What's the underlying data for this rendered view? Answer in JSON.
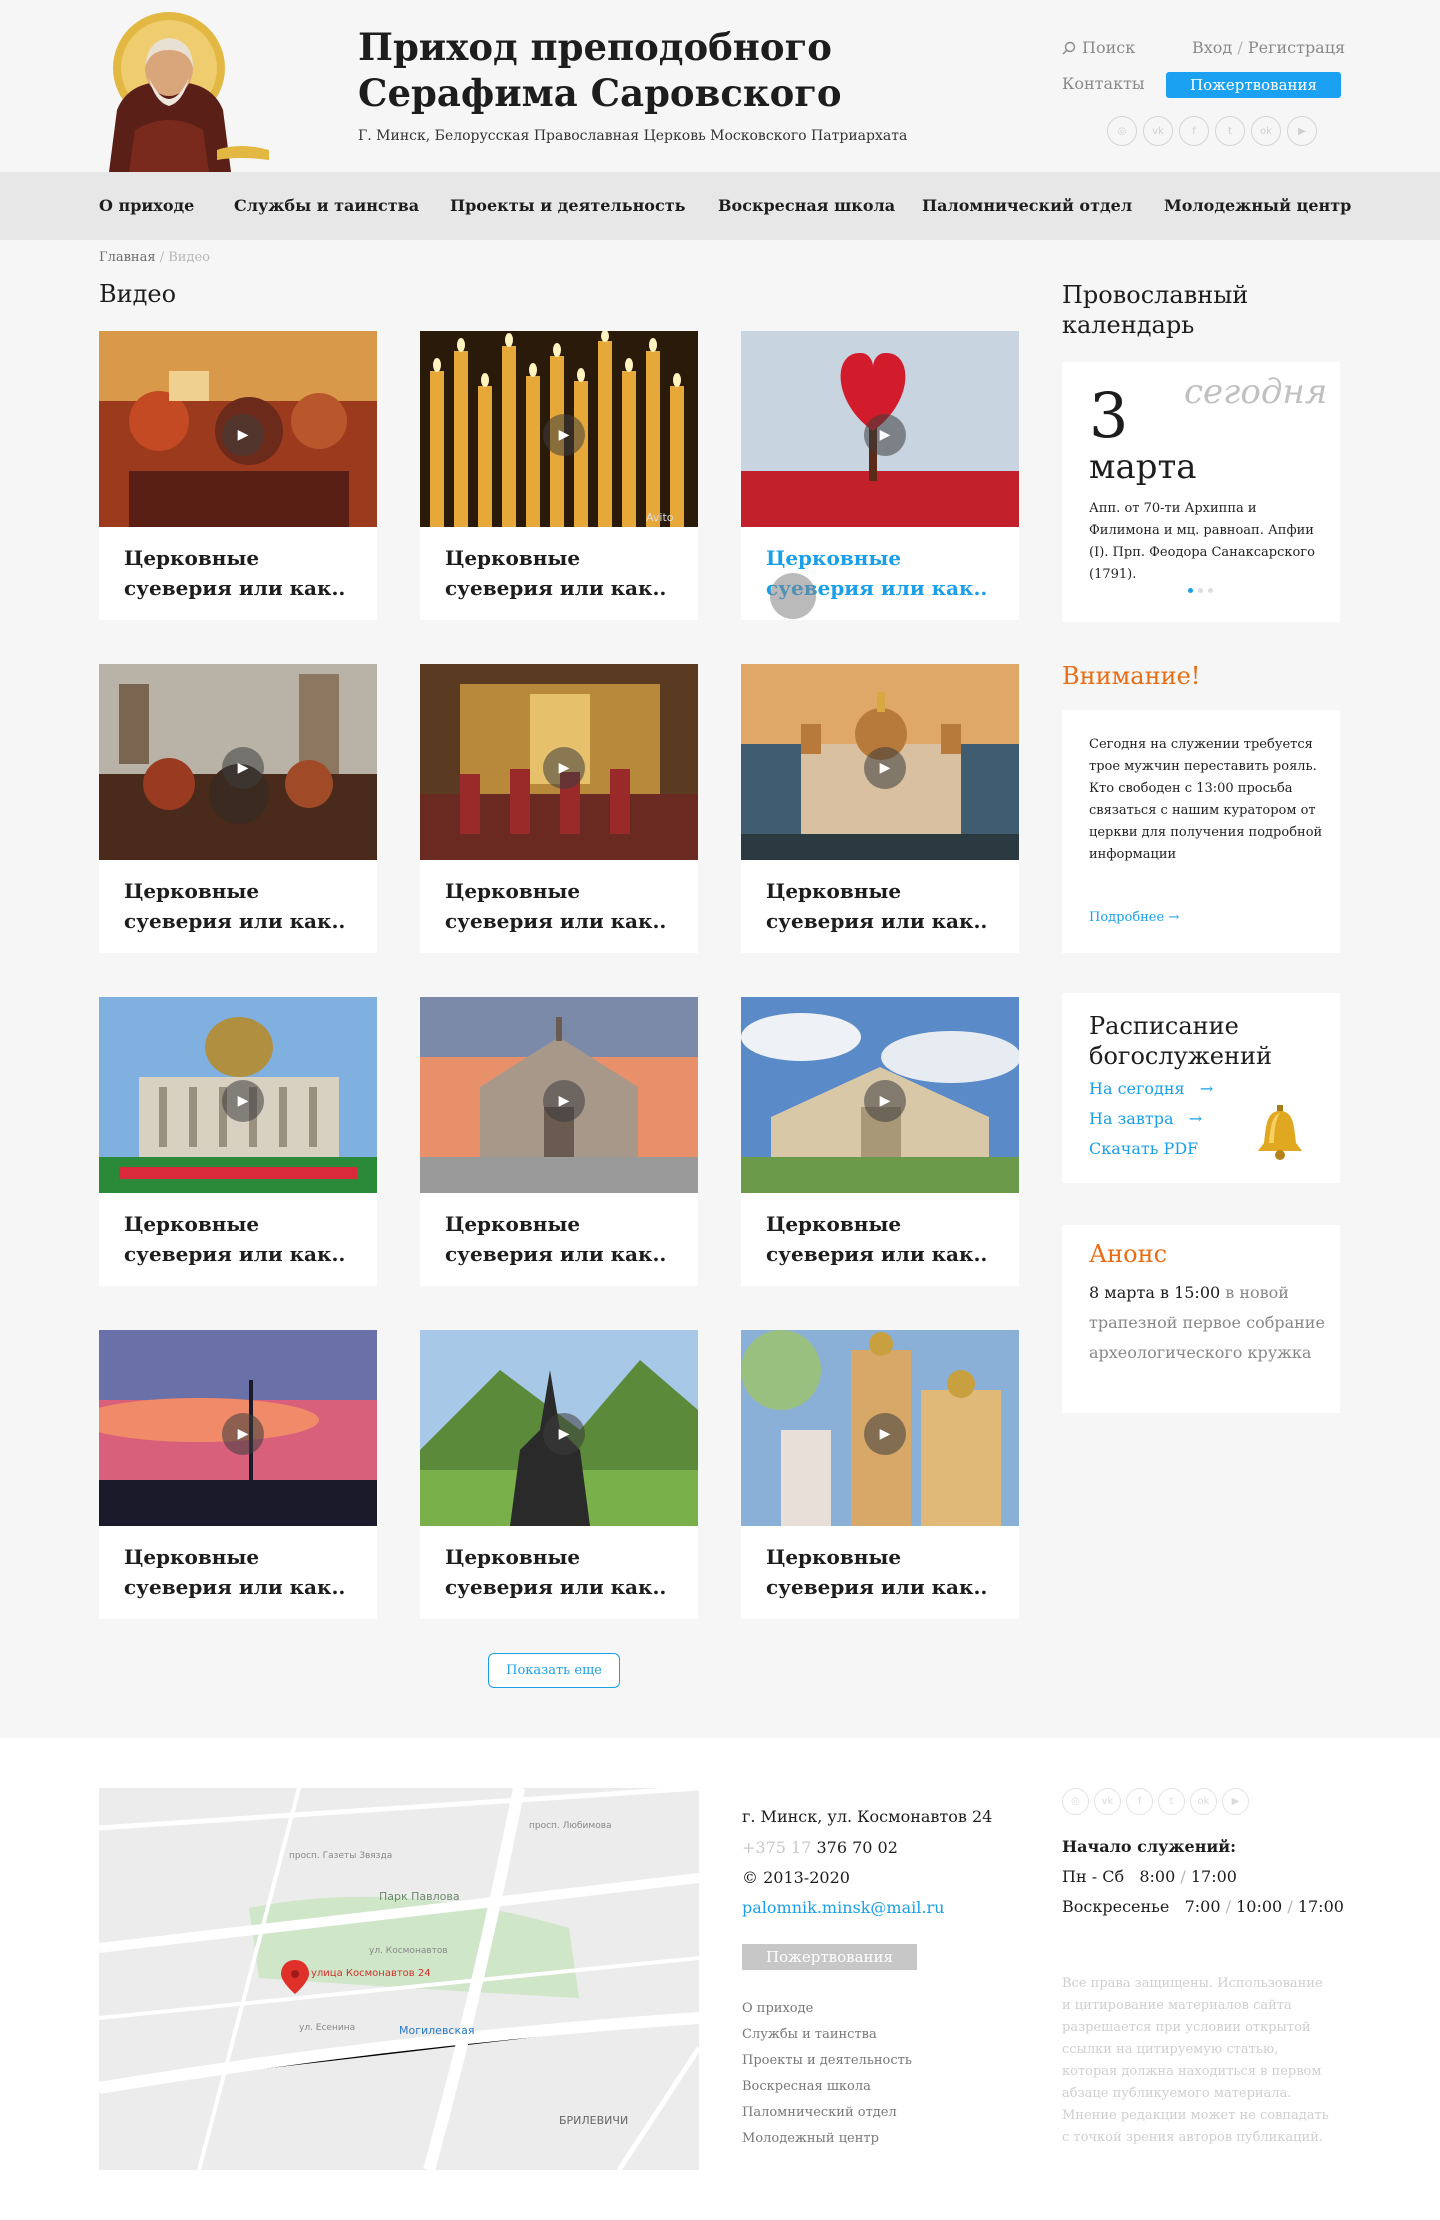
{
  "header": {
    "title_line1": "Приход преподобного",
    "title_line2": "Серафима Саровского",
    "subtitle": "Г. Минск, Белорусская Православная Церковь Московского Патриархата",
    "search_label": "Поиск",
    "login_label": "Вход",
    "login_sep": "/",
    "register_label": "Регистраця",
    "contacts_label": "Контакты",
    "donate_label": "Пожертвования",
    "socials": [
      "instagram-icon",
      "vk-icon",
      "facebook-icon",
      "twitter-icon",
      "odnoklassniki-icon",
      "youtube-icon"
    ]
  },
  "nav": {
    "items": [
      {
        "label": "О приходе"
      },
      {
        "label": "Службы и таинства"
      },
      {
        "label": "Проекты и деятельность"
      },
      {
        "label": "Воскресная школа"
      },
      {
        "label": "Паломнический отдел"
      },
      {
        "label": "Молодежный центр"
      }
    ]
  },
  "breadcrumb": {
    "home": "Главная",
    "sep": "/",
    "current": "Видео"
  },
  "page": {
    "title": "Видео"
  },
  "videos": [
    {
      "title": "Церковные суеверия или как..",
      "thumb": "council-painting"
    },
    {
      "title": "Церковные суеверия или как..",
      "thumb": "candles",
      "watermark": "Avito"
    },
    {
      "title": "Церковные суеверия или как..",
      "thumb": "heart-tree",
      "hovered": true
    },
    {
      "title": "Церковные суеверия или как..",
      "thumb": "historical-crowd"
    },
    {
      "title": "Церковные суеверия или как..",
      "thumb": "church-interior"
    },
    {
      "title": "Церковные суеверия или как..",
      "thumb": "cathedral-sunset"
    },
    {
      "title": "Церковные суеверия или как..",
      "thumb": "isaac-cathedral"
    },
    {
      "title": "Церковные суеверия или как..",
      "thumb": "modern-church-dusk"
    },
    {
      "title": "Церковные суеверия или как..",
      "thumb": "modern-church-day"
    },
    {
      "title": "Церковные суеверия или как..",
      "thumb": "spire-sunset"
    },
    {
      "title": "Церковные суеверия или как..",
      "thumb": "stave-church"
    },
    {
      "title": "Церковные суеверия или как..",
      "thumb": "woman-church"
    }
  ],
  "show_more_label": "Показать еще",
  "sidebar": {
    "calendar_title": "Провославный календарь",
    "calendar": {
      "day": "3",
      "today_label": "сегодня",
      "month": "марта",
      "saints": "Апп. от 70-ти Архиппа и Филимона и мц. равноап. Апфии (I). Прп. Феодора Санаксарского (1791)."
    },
    "attention": {
      "title": "Внимание!",
      "text": "Сегодня на служении требуется трое мужчин переставить рояль. Кто свободен с 13:00 просьба связаться с нашим куратором от церкви для получения подробной информации",
      "more_label": "Подробнее",
      "more_arrow": "→"
    },
    "schedule": {
      "title": "Расписание богослужений",
      "links": [
        {
          "label": "На сегодня",
          "arrow": "→"
        },
        {
          "label": "На завтра",
          "arrow": "→"
        },
        {
          "label": "Скачать PDF",
          "arrow": ""
        }
      ]
    },
    "announce": {
      "title": "Анонс",
      "date": "8 марта в 15:00",
      "text": " в новой трапезной первое собрание археологического кружка"
    }
  },
  "footer": {
    "address": "г. Минск, ул. Космонавтов 24",
    "phone_prefix": "+375 17",
    "phone": "376 70 02",
    "copyright": "©  2013-2020",
    "email": "palomnik.minsk@mail.ru",
    "donate_label": "Пожертвования",
    "links": [
      "О приходе",
      "Службы и таинства",
      "Проекты и деятельность",
      "Воскресная школа",
      "Паломнический отдел",
      "Молодежный центр"
    ],
    "service_title": "Начало служений:",
    "schedule": [
      {
        "days": "Пн - Сб",
        "times": [
          "8:00",
          "17:00"
        ]
      },
      {
        "days": "Воскресенье",
        "times": [
          "7:00",
          "10:00",
          "17:00"
        ]
      }
    ],
    "legal": "Все права защищены. Использование и цитирование материалов сайта разрешается при условии открытой ссылки на цитируемую статью, которая должна находиться в первом абзаце публикуемого материала. Мнение редакции может не совпадать с точкой зрения авторов публикаций.",
    "map": {
      "park_label": "Парк Павлова",
      "street_label": "улица Космонавтов 24",
      "metro_label": "Могилевская",
      "district_label": "БРИЛЕВИЧИ",
      "road_labels": [
        "ул. Космонавтов",
        "ул. Есенина",
        "просп. Любимова",
        "просп. Газеты Звязда"
      ]
    }
  },
  "colors": {
    "accent_blue": "#1aa1f2",
    "accent_orange": "#e86d14",
    "nav_bg": "#e7e7e7"
  }
}
